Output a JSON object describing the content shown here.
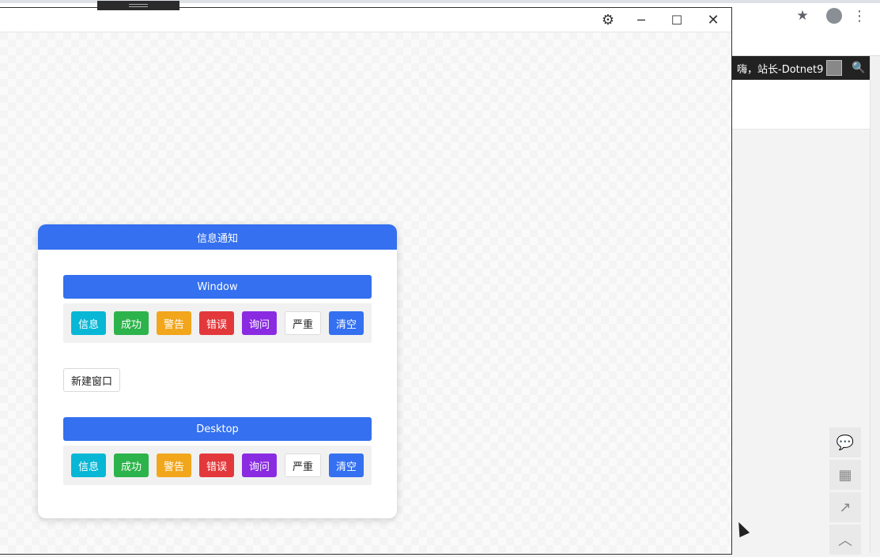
{
  "browser": {
    "site_greeting": "嗨，站长-Dotnet9"
  },
  "icons": {
    "star": "★",
    "menu": "⋮",
    "search": "🔍",
    "settings": "⚙",
    "minimize": "─",
    "maximize": "☐",
    "close": "✕",
    "comment": "💬",
    "qrcode": "▦",
    "share": "↗",
    "back_to_top": "︿"
  },
  "panel": {
    "title": "信息通知",
    "window_section": {
      "title": "Window",
      "buttons": [
        "信息",
        "成功",
        "警告",
        "错误",
        "询问",
        "严重",
        "清空"
      ]
    },
    "new_window_label": "新建窗口",
    "desktop_section": {
      "title": "Desktop",
      "buttons": [
        "信息",
        "成功",
        "警告",
        "错误",
        "询问",
        "严重",
        "清空"
      ]
    }
  },
  "colors": {
    "primary": "#3470ef",
    "info": "#08b7d5",
    "success": "#2db34b",
    "warning": "#f1a61c",
    "error": "#e3383b",
    "ask": "#8a2be2"
  }
}
